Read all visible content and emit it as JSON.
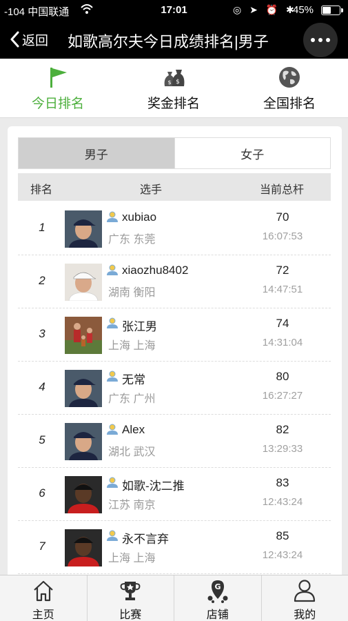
{
  "status_bar": {
    "signal": "-104 中国联通",
    "time": "17:01",
    "icons": "◎ ➤ ⏰ ✱",
    "battery": "45%",
    "battery_level": 0.45
  },
  "header": {
    "back_label": "返回",
    "title": "如歌高尔夫今日成绩排名|男子"
  },
  "top_tabs": [
    {
      "label": "今日排名",
      "icon": "flag-icon",
      "active": true
    },
    {
      "label": "奖金排名",
      "icon": "money-bag-icon",
      "active": false
    },
    {
      "label": "全国排名",
      "icon": "globe-icon",
      "active": false
    }
  ],
  "gender_tabs": [
    {
      "label": "男子",
      "active": true
    },
    {
      "label": "女子",
      "active": false
    }
  ],
  "table": {
    "headers": {
      "rank": "排名",
      "player": "选手",
      "score": "当前总杆"
    },
    "rows": [
      {
        "rank": "1",
        "name": "xubiao",
        "location": "广东 东莞",
        "score": "70",
        "time": "16:07:53",
        "avatar": "golfer-avatar"
      },
      {
        "rank": "2",
        "name": "xiaozhu8402",
        "location": "湖南 衡阳",
        "score": "72",
        "time": "14:47:51",
        "avatar": "golfer-white-cap-avatar"
      },
      {
        "rank": "3",
        "name": "张江男",
        "location": "上海 上海",
        "score": "74",
        "time": "14:31:04",
        "avatar": "family-photo-avatar"
      },
      {
        "rank": "4",
        "name": "无常",
        "location": "广东 广州",
        "score": "80",
        "time": "16:27:27",
        "avatar": "golfer-avatar"
      },
      {
        "rank": "5",
        "name": "Alex",
        "location": "湖北 武汉",
        "score": "82",
        "time": "13:29:33",
        "avatar": "golfer-avatar"
      },
      {
        "rank": "6",
        "name": "如歌-沈二推",
        "location": "江苏 南京",
        "score": "83",
        "time": "12:43:24",
        "avatar": "golfer-red-shirt-avatar"
      },
      {
        "rank": "7",
        "name": "永不言弃",
        "location": "上海 上海",
        "score": "85",
        "time": "12:43:24",
        "avatar": "golfer-red-shirt-avatar"
      }
    ]
  },
  "bottom_nav": [
    {
      "label": "主页",
      "icon": "home-icon"
    },
    {
      "label": "比赛",
      "icon": "trophy-icon"
    },
    {
      "label": "店铺",
      "icon": "store-location-icon"
    },
    {
      "label": "我的",
      "icon": "user-icon"
    }
  ],
  "colors": {
    "accent": "#4caf3c",
    "header_bg": "#000000",
    "page_bg": "#ebebeb"
  }
}
